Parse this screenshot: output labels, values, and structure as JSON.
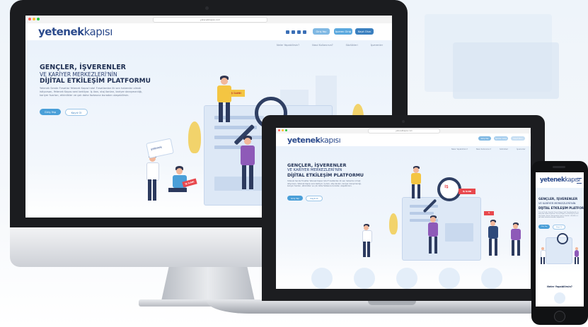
{
  "site": {
    "url": "yeteneKkapisi.com",
    "logo_part1": "yetenek",
    "logo_part2": "kapısı"
  },
  "header": {
    "btn_login": "Giriş Yap",
    "btn_employer": "İşveren Girişi",
    "btn_register": "Kayıt Olun"
  },
  "nav": {
    "items": [
      "Neler Yapabilirsin?",
      "Nasıl Kullanırsın?",
      "Sözlükleri",
      "İşverenler"
    ]
  },
  "hero": {
    "line1": "GENÇLER, İŞVERENLER",
    "line2": "VE KARİYER MERKEZLERİ'NİN",
    "line3": "DİJİTAL ETKİLEŞİM PLATFORMU",
    "description": "Yetenek Sende Fırsatlar Yetenek Kapısı'nda! Fırsatlardan ilk sen haberdar olmak istiyorsan, Yetenek Kapısı seni bekliyor. İş ilanı, staj ilanları, kariyer danışmanlığı, kariyer fuarları, etkinlikler ve çok daha fazlasına buradan ulaşabilirsin.",
    "btn_login": "Giriş Yap",
    "btn_register": "Kayıt Ol"
  },
  "illustration": {
    "tag_job": "İŞ İLANI",
    "tag_job_short": "İŞ",
    "mini_logo": "yetenek"
  },
  "mobile": {
    "section_title": "Neler Yapabilirsin?"
  },
  "colors": {
    "brand_navy": "#2b4a8c",
    "accent_blue": "#4a9fd8",
    "tag_red": "#e8484d",
    "figure_yellow": "#f4c542",
    "figure_purple": "#8e5ab8"
  }
}
